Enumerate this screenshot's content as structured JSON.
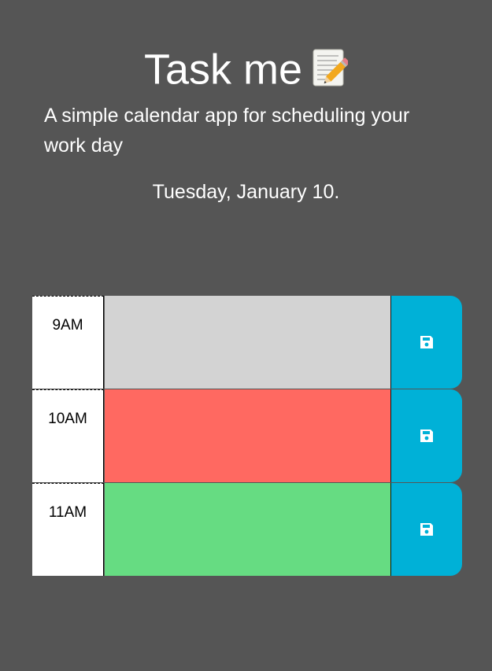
{
  "header": {
    "title": "Task me",
    "title_icon": "memo-icon",
    "lead": "A simple calendar app for scheduling your work day",
    "date": "Tuesday, January 10."
  },
  "colors": {
    "background": "#555555",
    "past": "#d3d3d3",
    "present": "#ff6961",
    "future": "#66dc82",
    "save_button": "#00b1d7"
  },
  "schedule": {
    "rows": [
      {
        "hour": "9AM",
        "state": "past",
        "task": "",
        "save_icon": "save-icon"
      },
      {
        "hour": "10AM",
        "state": "present",
        "task": "",
        "save_icon": "save-icon"
      },
      {
        "hour": "11AM",
        "state": "future",
        "task": "",
        "save_icon": "save-icon"
      }
    ]
  }
}
